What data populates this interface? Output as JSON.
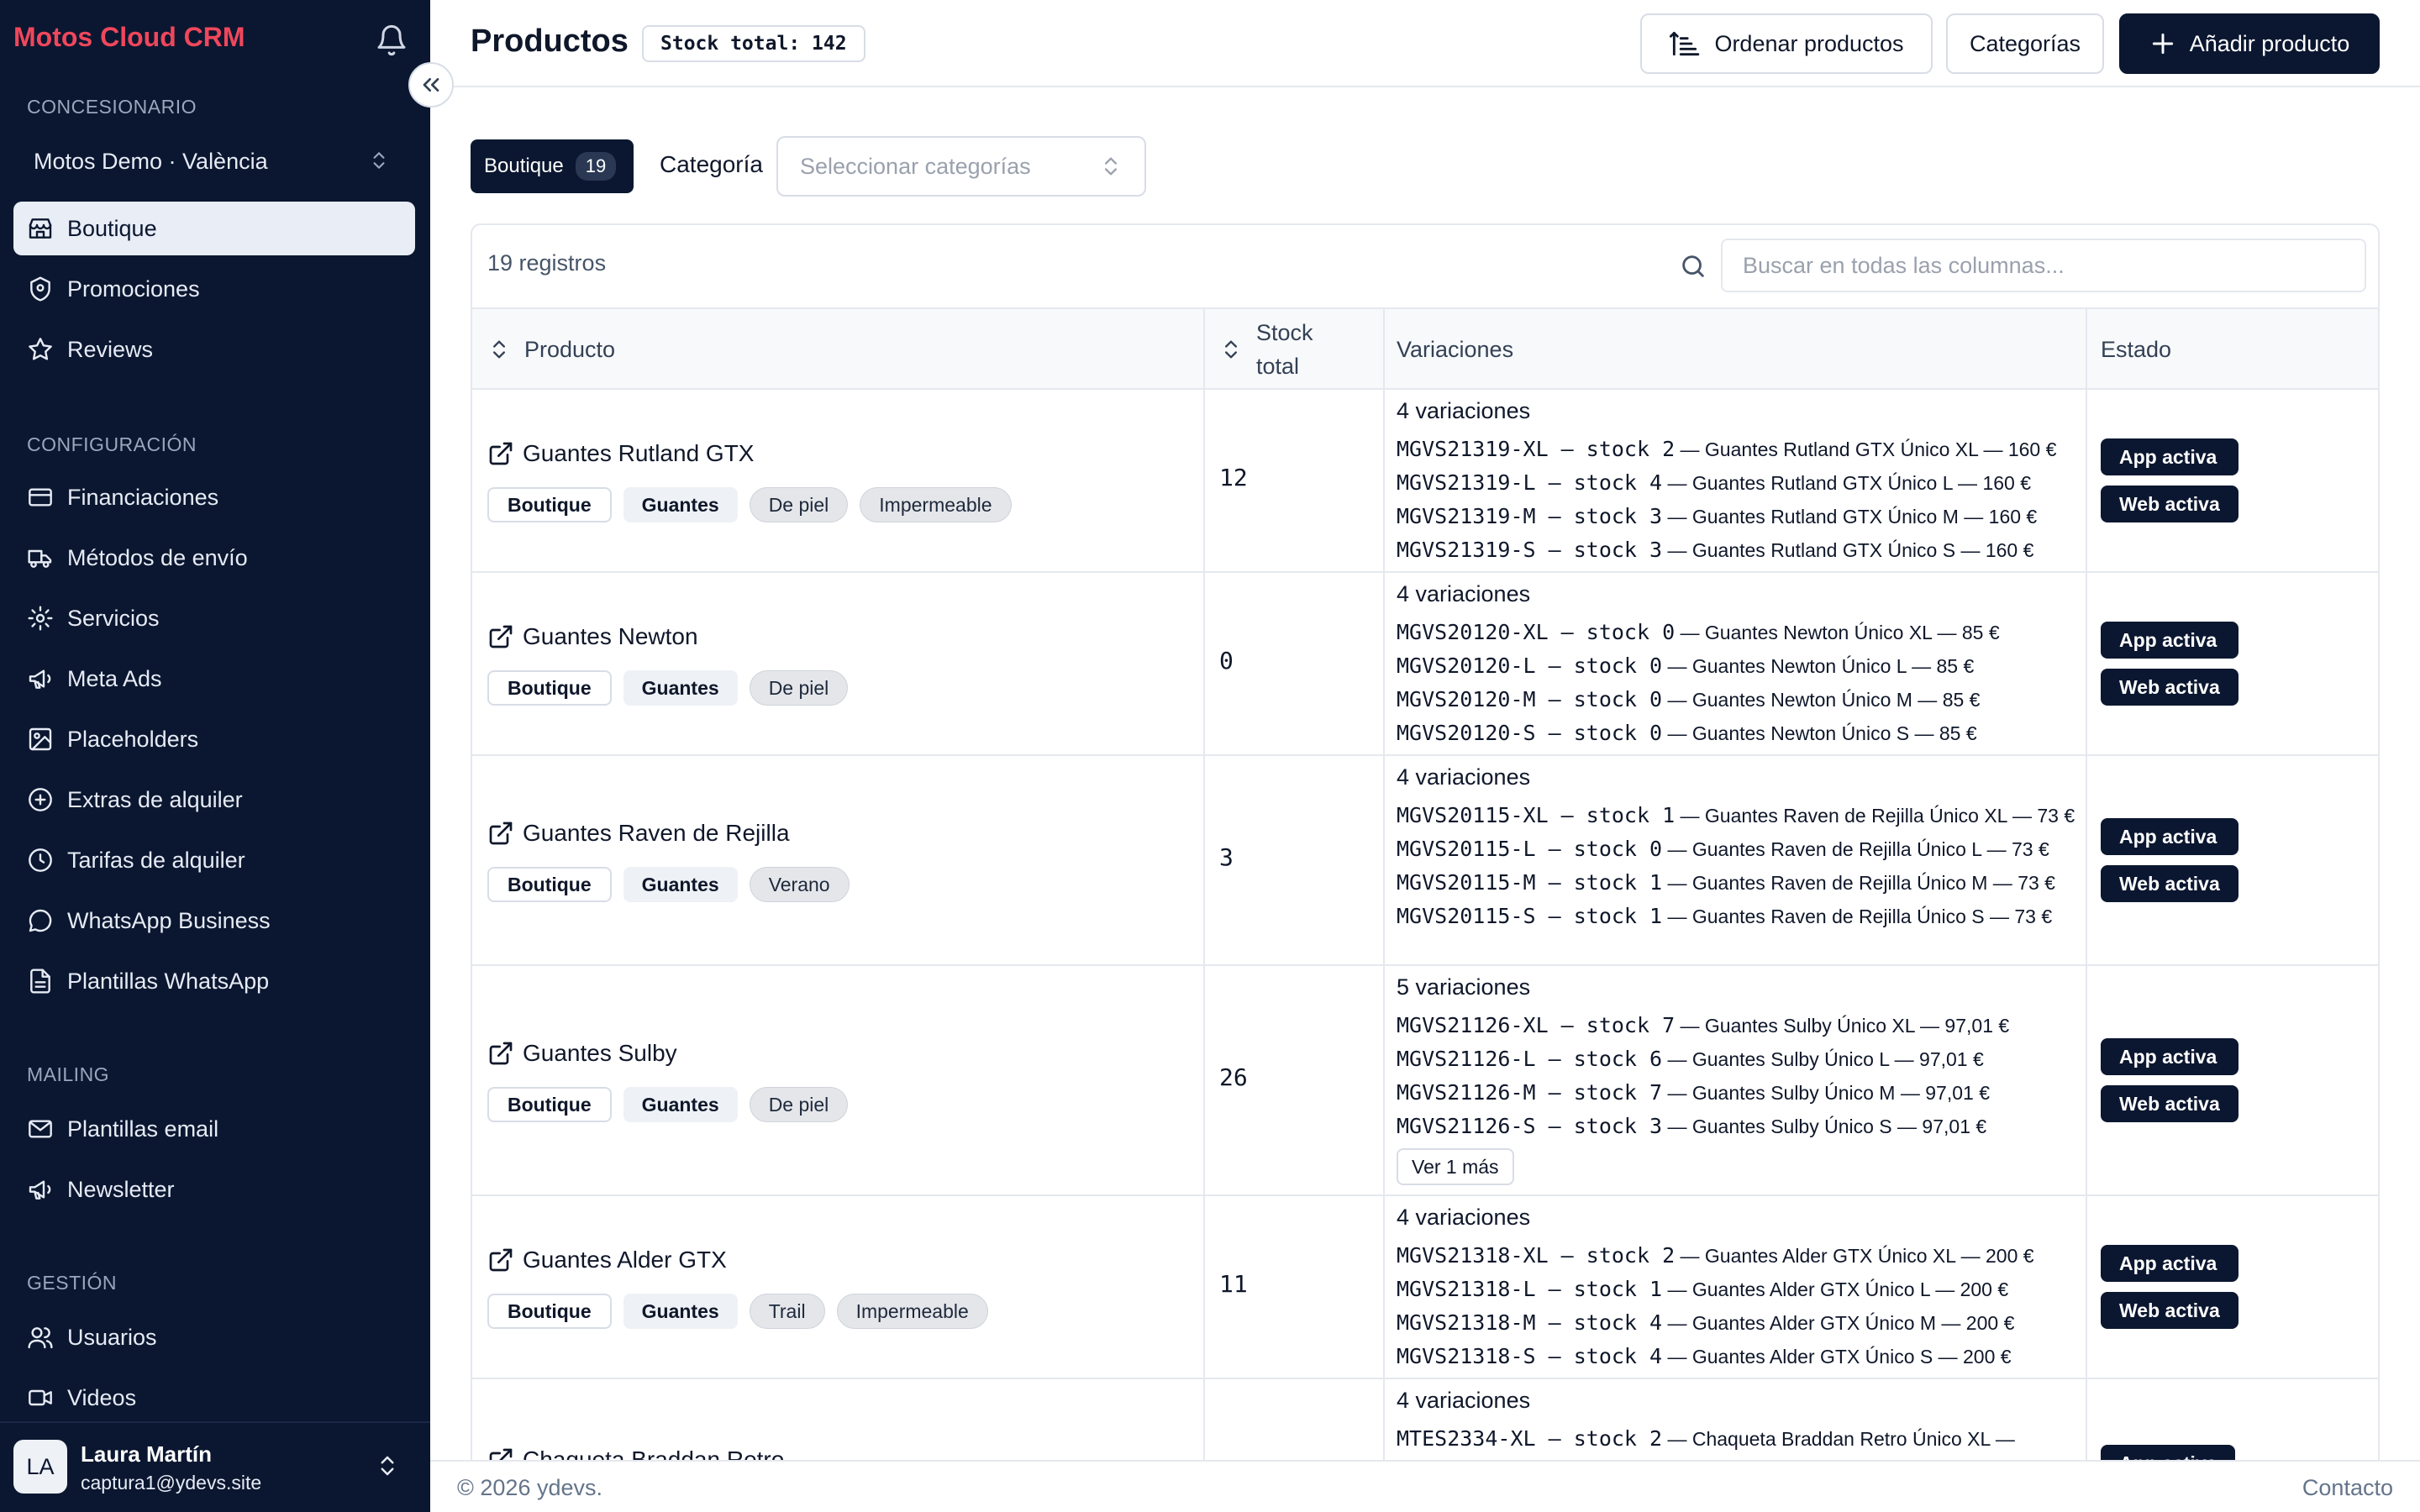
{
  "brand": "Motos Cloud CRM",
  "sidebar": {
    "dealer_section": "CONCESIONARIO",
    "dealer_selected": "Motos Demo · València",
    "items": [
      {
        "label": "Boutique",
        "icon": "store-icon",
        "active": true
      },
      {
        "label": "Promociones",
        "icon": "badge-icon"
      },
      {
        "label": "Reviews",
        "icon": "star-icon"
      }
    ],
    "config_section": "CONFIGURACIÓN",
    "config_items": [
      {
        "label": "Financiaciones",
        "icon": "credit-card-icon"
      },
      {
        "label": "Métodos de envío",
        "icon": "truck-icon"
      },
      {
        "label": "Servicios",
        "icon": "gear-icon"
      },
      {
        "label": "Meta Ads",
        "icon": "megaphone-icon"
      },
      {
        "label": "Placeholders",
        "icon": "image-icon"
      },
      {
        "label": "Extras de alquiler",
        "icon": "plus-circle-icon"
      },
      {
        "label": "Tarifas de alquiler",
        "icon": "clock-icon"
      },
      {
        "label": "WhatsApp Business",
        "icon": "chat-icon"
      },
      {
        "label": "Plantillas WhatsApp",
        "icon": "file-icon"
      }
    ],
    "mailing_section": "MAILING",
    "mailing_items": [
      {
        "label": "Plantillas email",
        "icon": "mail-icon"
      },
      {
        "label": "Newsletter",
        "icon": "megaphone-icon"
      }
    ],
    "gestion_section": "GESTIÓN",
    "gestion_items": [
      {
        "label": "Usuarios",
        "icon": "users-icon"
      },
      {
        "label": "Videos",
        "icon": "video-icon"
      }
    ],
    "user": {
      "initials": "LA",
      "name": "Laura Martín",
      "email": "captura1@ydevs.site"
    }
  },
  "header": {
    "title": "Productos",
    "stock_badge": "Stock total: 142",
    "sort_label": "Ordenar productos",
    "categories_label": "Categorías",
    "add_label": "Añadir producto"
  },
  "filters": {
    "boutique_label": "Boutique",
    "boutique_count": "19",
    "category_label": "Categoría",
    "category_placeholder": "Seleccionar categorías"
  },
  "table": {
    "records": "19 registros",
    "search_placeholder": "Buscar en todas las columnas...",
    "columns": {
      "product": "Producto",
      "stock_line1": "Stock",
      "stock_line2": "total",
      "variations": "Variaciones",
      "status": "Estado"
    },
    "rows": [
      {
        "name": "Guantes Rutland GTX",
        "tags": [
          "Boutique",
          "Guantes",
          "De piel",
          "Impermeable"
        ],
        "stock": "12",
        "var_count": "4 variaciones",
        "variations": [
          {
            "code": "MGVS21319-XL — stock 2",
            "desc": " — Guantes Rutland GTX Único XL — 160 €"
          },
          {
            "code": "MGVS21319-L — stock 4",
            "desc": " — Guantes Rutland GTX Único L — 160 €"
          },
          {
            "code": "MGVS21319-M — stock 3",
            "desc": " — Guantes Rutland GTX Único M — 160 €"
          },
          {
            "code": "MGVS21319-S — stock 3",
            "desc": " — Guantes Rutland GTX Único S — 160 €"
          }
        ],
        "status": [
          "App activa",
          "Web activa"
        ]
      },
      {
        "name": "Guantes Newton",
        "tags": [
          "Boutique",
          "Guantes",
          "De piel"
        ],
        "stock": "0",
        "var_count": "4 variaciones",
        "variations": [
          {
            "code": "MGVS20120-XL — stock 0",
            "desc": " — Guantes Newton Único XL — 85 €"
          },
          {
            "code": "MGVS20120-L — stock 0",
            "desc": " — Guantes Newton Único L — 85 €"
          },
          {
            "code": "MGVS20120-M — stock 0",
            "desc": " — Guantes Newton Único M — 85 €"
          },
          {
            "code": "MGVS20120-S — stock 0",
            "desc": " — Guantes Newton Único S — 85 €"
          }
        ],
        "status": [
          "App activa",
          "Web activa"
        ]
      },
      {
        "name": "Guantes Raven de Rejilla",
        "tags": [
          "Boutique",
          "Guantes",
          "Verano"
        ],
        "stock": "3",
        "var_count": "4 variaciones",
        "variations": [
          {
            "code": "MGVS20115-XL — stock 1",
            "desc": " — Guantes Raven de Rejilla Único XL — 73 €"
          },
          {
            "code": "MGVS20115-L — stock 0",
            "desc": " — Guantes Raven de Rejilla Único L — 73 €"
          },
          {
            "code": "MGVS20115-M — stock 1",
            "desc": " — Guantes Raven de Rejilla Único M — 73 €"
          },
          {
            "code": "MGVS20115-S — stock 1",
            "desc": " — Guantes Raven de Rejilla Único S — 73 €"
          }
        ],
        "status": [
          "App activa",
          "Web activa"
        ]
      },
      {
        "name": "Guantes Sulby",
        "tags": [
          "Boutique",
          "Guantes",
          "De piel"
        ],
        "stock": "26",
        "var_count": "5 variaciones",
        "variations": [
          {
            "code": "MGVS21126-XL — stock 7",
            "desc": " — Guantes Sulby Único XL — 97,01 €"
          },
          {
            "code": "MGVS21126-L — stock 6",
            "desc": " — Guantes Sulby Único L — 97,01 €"
          },
          {
            "code": "MGVS21126-M — stock 7",
            "desc": " — Guantes Sulby Único M — 97,01 €"
          },
          {
            "code": "MGVS21126-S — stock 3",
            "desc": " — Guantes Sulby Único S — 97,01 €"
          }
        ],
        "more": "Ver 1 más",
        "status": [
          "App activa",
          "Web activa"
        ]
      },
      {
        "name": "Guantes Alder GTX",
        "tags": [
          "Boutique",
          "Guantes",
          "Trail",
          "Impermeable"
        ],
        "stock": "11",
        "var_count": "4 variaciones",
        "variations": [
          {
            "code": "MGVS21318-XL — stock 2",
            "desc": " — Guantes Alder GTX Único XL — 200 €"
          },
          {
            "code": "MGVS21318-L — stock 1",
            "desc": " — Guantes Alder GTX Único L — 200 €"
          },
          {
            "code": "MGVS21318-M — stock 4",
            "desc": " — Guantes Alder GTX Único M — 200 €"
          },
          {
            "code": "MGVS21318-S — stock 4",
            "desc": " — Guantes Alder GTX Único S — 200 €"
          }
        ],
        "status": [
          "App activa",
          "Web activa"
        ]
      },
      {
        "name": "Chaqueta Braddan Retro",
        "tags": [],
        "stock": "",
        "var_count": "4 variaciones",
        "variations": [
          {
            "code": "MTES2334-XL — stock 2",
            "desc": " — Chaqueta Braddan Retro Único XL —"
          }
        ],
        "status": [
          "App activa"
        ]
      }
    ]
  },
  "footer": {
    "copyright": "© 2026 ydevs.",
    "contact": "Contacto"
  }
}
